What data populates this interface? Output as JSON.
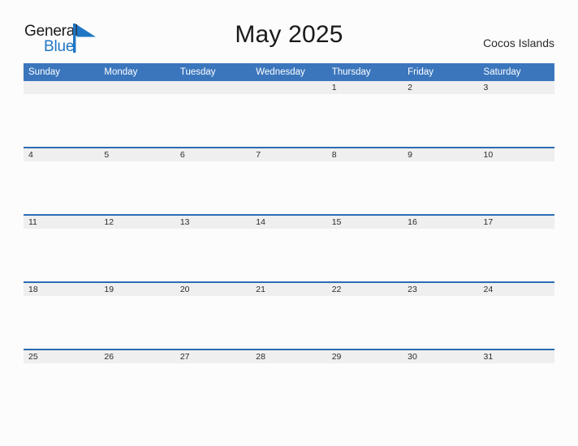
{
  "brand": {
    "name_part1": "General",
    "name_part2": "Blue",
    "flag_color": "#1f76c4"
  },
  "header": {
    "title": "May 2025",
    "region": "Cocos Islands"
  },
  "colors": {
    "header_blue": "#3b76bd",
    "row_divider_blue": "#2d6cb3",
    "date_band_gray": "#efefef",
    "page_background": "#fcfcfc",
    "text_dark": "#2b2b2b"
  },
  "calendar": {
    "weekday_headers": [
      "Sunday",
      "Monday",
      "Tuesday",
      "Wednesday",
      "Thursday",
      "Friday",
      "Saturday"
    ],
    "weeks": [
      [
        "",
        "",
        "",
        "",
        "1",
        "2",
        "3"
      ],
      [
        "4",
        "5",
        "6",
        "7",
        "8",
        "9",
        "10"
      ],
      [
        "11",
        "12",
        "13",
        "14",
        "15",
        "16",
        "17"
      ],
      [
        "18",
        "19",
        "20",
        "21",
        "22",
        "23",
        "24"
      ],
      [
        "25",
        "26",
        "27",
        "28",
        "29",
        "30",
        "31"
      ]
    ]
  }
}
